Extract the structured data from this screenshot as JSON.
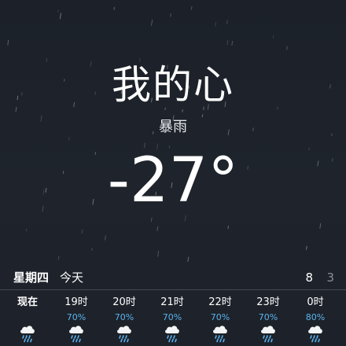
{
  "location": {
    "name": "我的心",
    "condition": "暴雨",
    "temperature": "-27°"
  },
  "day_summary": {
    "weekday": "星期四",
    "today_label": "今天",
    "high": "8",
    "low": "3"
  },
  "hourly": [
    {
      "label": "现在",
      "probability": "",
      "icon": "rain-cloud-icon"
    },
    {
      "label": "19时",
      "probability": "70%",
      "icon": "rain-cloud-icon"
    },
    {
      "label": "20时",
      "probability": "70%",
      "icon": "rain-cloud-icon"
    },
    {
      "label": "21时",
      "probability": "70%",
      "icon": "rain-cloud-icon"
    },
    {
      "label": "22时",
      "probability": "70%",
      "icon": "rain-cloud-icon"
    },
    {
      "label": "23时",
      "probability": "70%",
      "icon": "rain-cloud-icon"
    },
    {
      "label": "0时",
      "probability": "80%",
      "icon": "rain-cloud-icon"
    }
  ],
  "colors": {
    "background": "#1e232b",
    "probability": "#5ab4f0",
    "low_temp": "#8a8f96"
  }
}
